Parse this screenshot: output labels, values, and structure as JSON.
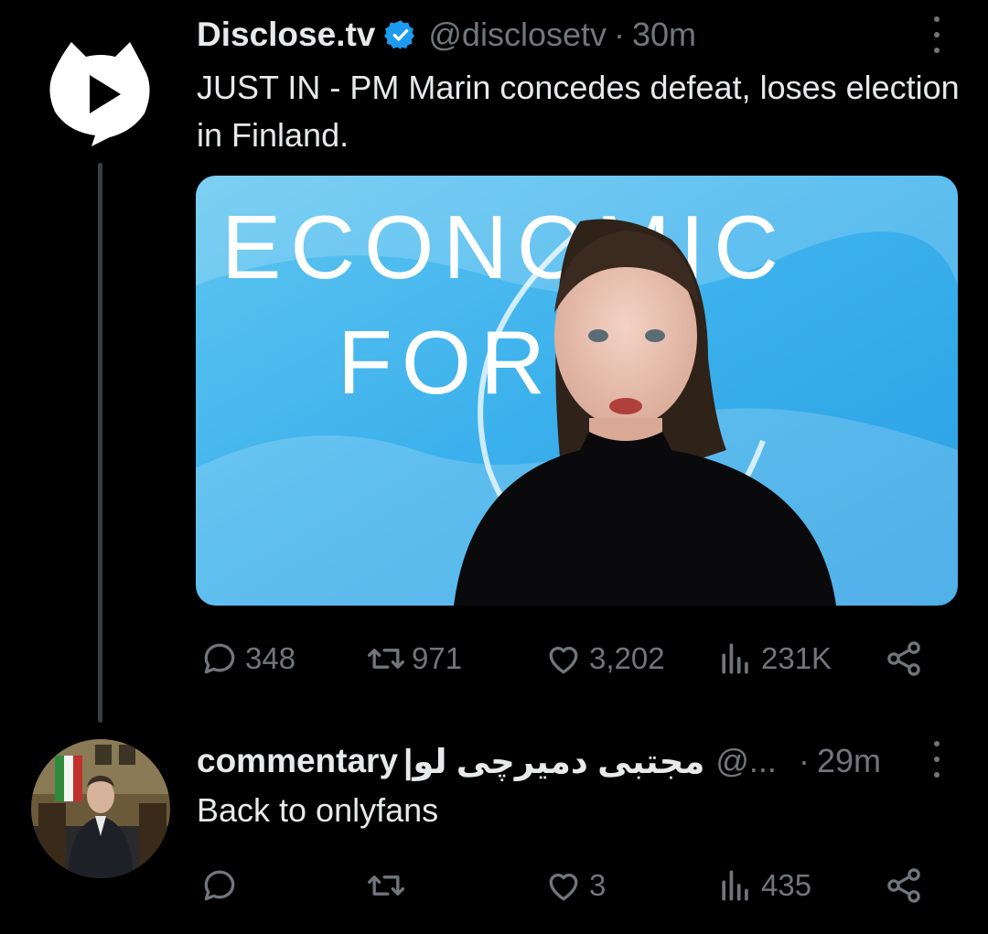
{
  "tweets": [
    {
      "display_name": "Disclose.tv",
      "verified": true,
      "handle": "@disclosetv",
      "separator": "·",
      "time": "30m",
      "text": "JUST IN - PM Marin concedes defeat, loses election in Finland.",
      "media_text": {
        "line1": "ECONOMIC",
        "line2": "FORUM"
      },
      "stats": {
        "replies": "348",
        "reposts": "971",
        "likes": "3,202",
        "views": "231K"
      }
    },
    {
      "display_name": "commentary",
      "display_name_rtl": "مجتبی دمیرچی لو|",
      "handle": "@...",
      "separator": "·",
      "time": "29m",
      "text": "Back to onlyfans",
      "stats": {
        "replies": "",
        "reposts": "",
        "likes": "3",
        "views": "435"
      }
    }
  ],
  "icons": [
    "reply-icon",
    "repost-icon",
    "like-icon",
    "views-icon",
    "share-icon",
    "more-icon",
    "verified-badge-icon"
  ],
  "colors": {
    "background": "#000000",
    "text": "#e7e9ea",
    "muted": "#71767b",
    "verified": "#1d9bf0"
  }
}
